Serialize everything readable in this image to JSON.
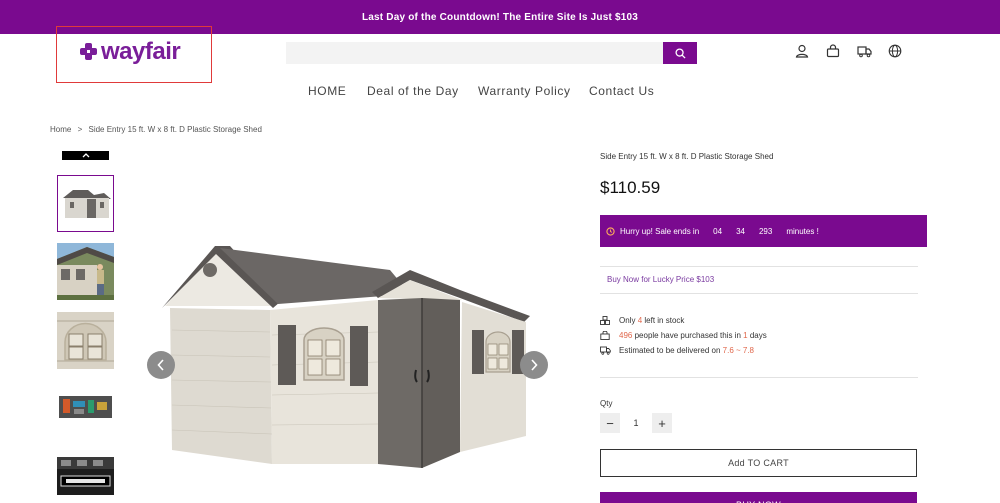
{
  "announcement": "Last Day of the Countdown! The Entire Site Is Just $103",
  "brand": {
    "logo_text": "wayfair",
    "accent": "#7a0a8f"
  },
  "search": {
    "placeholder": "",
    "button_icon": "search-icon"
  },
  "header_icons": [
    "user-icon",
    "shopping-bag-icon",
    "truck-icon",
    "globe-icon"
  ],
  "nav": [
    "HOME",
    "Deal of the Day",
    "Warranty Policy",
    "Contact Us"
  ],
  "breadcrumb": {
    "home": "Home",
    "separator": ">",
    "current": "Side Entry 15 ft. W x 8 ft. D Plastic Storage Shed"
  },
  "product": {
    "title": "Side Entry 15 ft. W x 8 ft. D Plastic Storage Shed",
    "price": "$110.59",
    "timer": {
      "label": "Hurry up! Sale ends in",
      "hours": "04",
      "minutes": "34",
      "millis": "293",
      "suffix": "minutes !"
    },
    "lucky_price": "Buy Now for Lucky Price $103",
    "stock": {
      "prefix": "Only",
      "count": "4",
      "suffix": "left in stock"
    },
    "purchased": {
      "count": "496",
      "middle": "people have purchased this in",
      "days": "1",
      "suffix": "days"
    },
    "delivery": {
      "prefix": "Estimated to be delivered on",
      "dates": "7.6 ~ 7.8"
    }
  },
  "quantity": {
    "label": "Qty",
    "value": "1",
    "minus": "−",
    "plus": "+"
  },
  "buttons": {
    "add_to_cart": "Add TO CART",
    "buy_now": "BUY NOW"
  }
}
